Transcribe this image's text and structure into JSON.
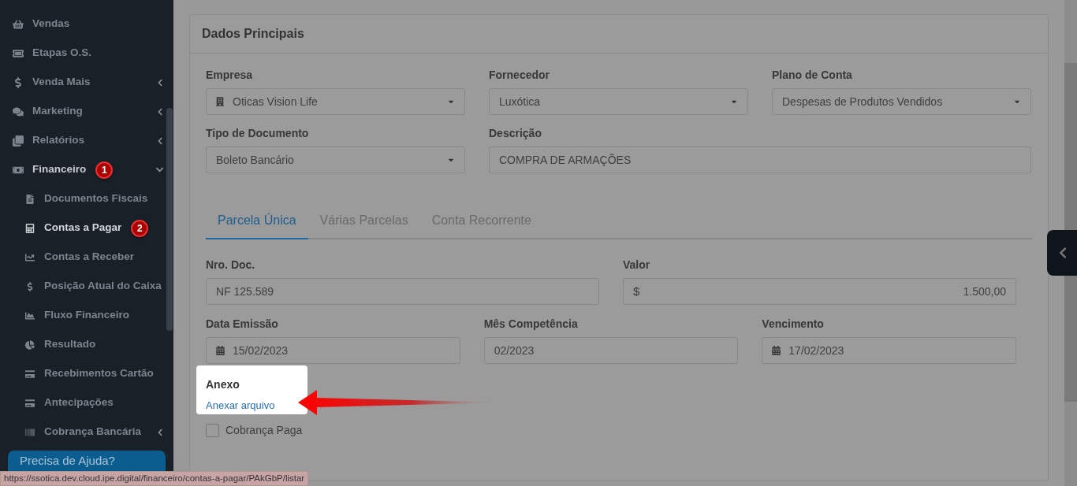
{
  "sidebar": {
    "items": [
      {
        "label": "Vendas"
      },
      {
        "label": "Etapas O.S."
      },
      {
        "label": "Venda Mais",
        "expanded": false
      },
      {
        "label": "Marketing",
        "expanded": false
      },
      {
        "label": "Relatórios",
        "expanded": false
      },
      {
        "label": "Financeiro",
        "expanded": true,
        "marker": "1",
        "children": [
          {
            "label": "Documentos Fiscais",
            "selected": false
          },
          {
            "label": "Contas a Pagar",
            "selected": true,
            "marker": "2"
          },
          {
            "label": "Contas a Receber",
            "selected": false
          },
          {
            "label": "Posição Atual do Caixa",
            "selected": false
          },
          {
            "label": "Fluxo Financeiro",
            "selected": false
          },
          {
            "label": "Resultado",
            "selected": false
          },
          {
            "label": "Recebimentos Cartão",
            "selected": false
          },
          {
            "label": "Antecipações",
            "selected": false
          },
          {
            "label": "Cobrança Bancária",
            "selected": false,
            "expanded": false
          }
        ]
      }
    ]
  },
  "help_button": "Precisa de Ajuda?",
  "status_bar": "https://ssotica.dev.cloud.ipe.digital/financeiro/contas-a-pagar/PAkGbP/listar",
  "card": {
    "title": "Dados Principais",
    "fields": [
      {
        "label": "Empresa",
        "value": "Oticas Vision Life",
        "kind": "select",
        "icon": true
      },
      {
        "label": "Fornecedor",
        "value": "Luxótica",
        "kind": "select"
      },
      {
        "label": "Plano de Conta",
        "value": "Despesas de Produtos Vendidos",
        "kind": "select"
      },
      {
        "label": "Tipo de Documento",
        "value": "Boleto Bancário",
        "kind": "select"
      },
      {
        "label": "Descrição",
        "value": "COMPRA DE ARMAÇÕES",
        "kind": "text",
        "wide": true
      }
    ],
    "tabs": [
      {
        "label": "Parcela Única",
        "selected": true
      },
      {
        "label": "Várias Parcelas",
        "selected": false
      },
      {
        "label": "Conta Recorrente",
        "selected": false
      }
    ],
    "payment_fields": [
      {
        "label": "Nro. Doc.",
        "value": "NF 125.589",
        "kind": "text"
      },
      {
        "label": "Valor",
        "value": "1.500,00",
        "prefix": "$",
        "kind": "currency"
      }
    ],
    "date_fields": [
      {
        "label": "Data Emissão",
        "value": "15/02/2023",
        "kind": "date"
      },
      {
        "label": "Mês Competência",
        "value": "02/2023",
        "kind": "text"
      },
      {
        "label": "Vencimento",
        "value": "17/02/2023",
        "kind": "date"
      }
    ],
    "attachment": {
      "label": "Anexo",
      "link": "Anexar arquivo",
      "highlighted": true
    },
    "paid_checkbox": {
      "label": "Cobrança Paga",
      "checked": false
    }
  }
}
